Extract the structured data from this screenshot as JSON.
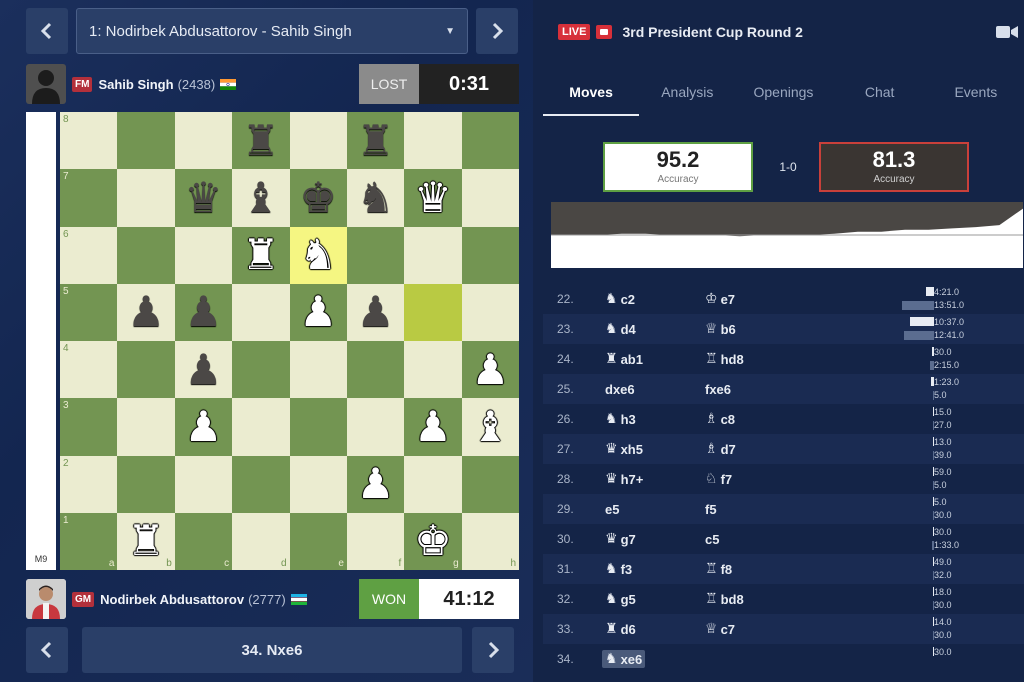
{
  "nav": {
    "prev_icon": "chevron-left-icon",
    "next_icon": "chevron-right-icon"
  },
  "game_select": {
    "value": "1: Nodirbek Abdusattorov - Sahib Singh"
  },
  "top_player": {
    "title": "FM",
    "name": "Sahib Singh",
    "rating": "(2438)",
    "flag": "India",
    "result": "LOST",
    "clock": "0:31"
  },
  "bottom_player": {
    "title": "GM",
    "name": "Nodirbek Abdusattorov",
    "rating": "(2777)",
    "flag": "Uzbekistan",
    "result": "WON",
    "clock": "41:12"
  },
  "eval": {
    "label": "M9"
  },
  "board": {
    "files": [
      "a",
      "b",
      "c",
      "d",
      "e",
      "f",
      "g",
      "h"
    ],
    "ranks": [
      "8",
      "7",
      "6",
      "5",
      "4",
      "3",
      "2",
      "1"
    ],
    "highlight": [
      "e6",
      "g5"
    ],
    "pieces": {
      "d8": "bR",
      "f8": "bR",
      "c7": "bQ",
      "d7": "bB",
      "e7": "bK",
      "f7": "bN",
      "g7": "wQ",
      "d6": "wR",
      "e6": "wN",
      "b5": "bP",
      "c5": "bP",
      "e5": "wP",
      "f5": "bP",
      "c4": "bP",
      "h4": "wP",
      "c3": "wP",
      "g3": "wP",
      "h3": "wB",
      "f2": "wP",
      "b1": "wR",
      "g1": "wK"
    }
  },
  "bottom_nav": {
    "current_move": "34. Nxe6"
  },
  "header": {
    "live": "LIVE",
    "event": "3rd President Cup Round 2",
    "video_icon": "video-camera-icon"
  },
  "tabs": [
    "Moves",
    "Analysis",
    "Openings",
    "Chat",
    "Events"
  ],
  "accuracy": {
    "white": "95.2",
    "black": "81.3",
    "label": "Accuracy",
    "score": "1-0"
  },
  "graph": {
    "eval_series": [
      0.5,
      0.5,
      0.5,
      0.48,
      0.48,
      0.5,
      0.5,
      0.5,
      0.52,
      0.5,
      0.5,
      0.5,
      0.48,
      0.45,
      0.45,
      0.42,
      0.42,
      0.4,
      0.38,
      0.35,
      0.1
    ]
  },
  "moves": [
    {
      "num": "22.",
      "w_piece": "N",
      "w": "c2",
      "b_piece": "K",
      "b": "e7",
      "wt": "4:21.0",
      "bt": "13:51.0",
      "wbar": 8,
      "bbar": 32
    },
    {
      "num": "23.",
      "w_piece": "N",
      "w": "d4",
      "b_piece": "Q",
      "b": "b6",
      "wt": "10:37.0",
      "bt": "12:41.0",
      "wbar": 24,
      "bbar": 30
    },
    {
      "num": "24.",
      "w_piece": "R",
      "w": "ab1",
      "b_piece": "R",
      "b": "hd8",
      "wt": "30.0",
      "bt": "2:15.0",
      "wbar": 2,
      "bbar": 4
    },
    {
      "num": "25.",
      "w_piece": "",
      "w": "dxe6",
      "b_piece": "",
      "b": "fxe6",
      "wt": "1:23.0",
      "bt": "5.0",
      "wbar": 3,
      "bbar": 1
    },
    {
      "num": "26.",
      "w_piece": "N",
      "w": "h3",
      "b_piece": "B",
      "b": "c8",
      "wt": "15.0",
      "bt": "27.0",
      "wbar": 1,
      "bbar": 1
    },
    {
      "num": "27.",
      "w_piece": "Q",
      "w": "xh5",
      "b_piece": "B",
      "b": "d7",
      "wt": "13.0",
      "bt": "39.0",
      "wbar": 1,
      "bbar": 1
    },
    {
      "num": "28.",
      "w_piece": "Q",
      "w": "h7+",
      "b_piece": "N",
      "b": "f7",
      "wt": "59.0",
      "bt": "5.0",
      "wbar": 1,
      "bbar": 1
    },
    {
      "num": "29.",
      "w_piece": "",
      "w": "e5",
      "b_piece": "",
      "b": "f5",
      "wt": "5.0",
      "bt": "30.0",
      "wbar": 1,
      "bbar": 1
    },
    {
      "num": "30.",
      "w_piece": "Q",
      "w": "g7",
      "b_piece": "",
      "b": "c5",
      "wt": "30.0",
      "bt": "1:33.0",
      "wbar": 1,
      "bbar": 2
    },
    {
      "num": "31.",
      "w_piece": "N",
      "w": "f3",
      "b_piece": "R",
      "b": "f8",
      "wt": "49.0",
      "bt": "32.0",
      "wbar": 1,
      "bbar": 1
    },
    {
      "num": "32.",
      "w_piece": "N",
      "w": "g5",
      "b_piece": "R",
      "b": "bd8",
      "wt": "18.0",
      "bt": "30.0",
      "wbar": 1,
      "bbar": 1
    },
    {
      "num": "33.",
      "w_piece": "R",
      "w": "d6",
      "b_piece": "Q",
      "b": "c7",
      "wt": "14.0",
      "bt": "30.0",
      "wbar": 1,
      "bbar": 1
    },
    {
      "num": "34.",
      "w_piece": "N",
      "w": "xe6",
      "b_piece": "",
      "b": "",
      "wt": "30.0",
      "bt": "",
      "wbar": 1,
      "bbar": 0
    }
  ]
}
